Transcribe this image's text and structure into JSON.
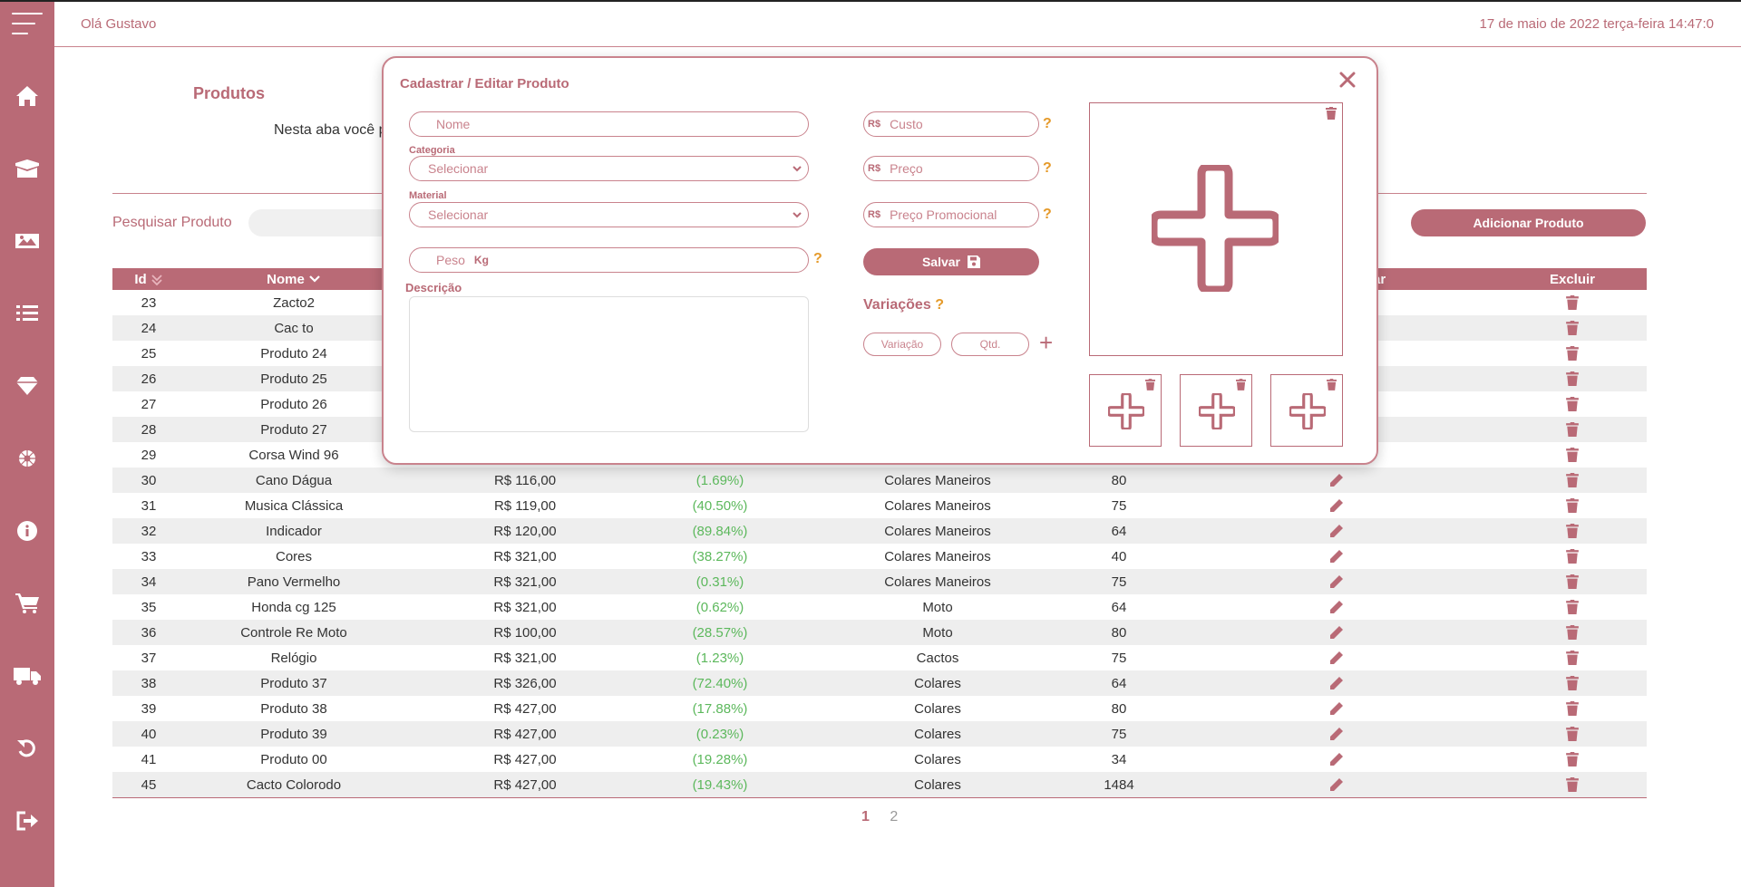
{
  "header": {
    "greeting": "Olá Gustavo",
    "datetime": "17 de maio de 2022 terça-feira 14:47:0"
  },
  "sidebar": {
    "items": [
      {
        "icon": "menu-icon"
      },
      {
        "icon": "home-icon"
      },
      {
        "icon": "box-icon"
      },
      {
        "icon": "image-icon"
      },
      {
        "icon": "list-icon"
      },
      {
        "icon": "diamond-icon"
      },
      {
        "icon": "settings-icon"
      },
      {
        "icon": "info-icon"
      },
      {
        "icon": "cart-icon"
      },
      {
        "icon": "truck-icon"
      },
      {
        "icon": "undo-icon"
      },
      {
        "icon": "logout-icon"
      }
    ]
  },
  "page": {
    "title": "Produtos",
    "description": "Nesta aba você p",
    "search_label": "Pesquisar Produto",
    "add_button": "Adicionar Produto"
  },
  "table": {
    "headers": {
      "id": "Id",
      "name": "Nome",
      "edit": "ar",
      "delete": "Excluir"
    },
    "rows": [
      {
        "id": "23",
        "name": "Zacto2",
        "price": "",
        "pct": "",
        "category": "",
        "qty": ""
      },
      {
        "id": "24",
        "name": "Cac to",
        "price": "",
        "pct": "",
        "category": "",
        "qty": ""
      },
      {
        "id": "25",
        "name": "Produto 24",
        "price": "",
        "pct": "",
        "category": "",
        "qty": ""
      },
      {
        "id": "26",
        "name": "Produto 25",
        "price": "",
        "pct": "",
        "category": "",
        "qty": ""
      },
      {
        "id": "27",
        "name": "Produto 26",
        "price": "",
        "pct": "",
        "category": "",
        "qty": ""
      },
      {
        "id": "28",
        "name": "Produto 27",
        "price": "",
        "pct": "",
        "category": "",
        "qty": ""
      },
      {
        "id": "29",
        "name": "Corsa Wind 96",
        "price": "",
        "pct": "",
        "category": "",
        "qty": ""
      },
      {
        "id": "30",
        "name": "Cano Dágua",
        "price": "R$ 116,00",
        "pct": "(1.69%)",
        "category": "Colares Maneiros",
        "qty": "80"
      },
      {
        "id": "31",
        "name": "Musica Clássica",
        "price": "R$ 119,00",
        "pct": "(40.50%)",
        "category": "Colares Maneiros",
        "qty": "75"
      },
      {
        "id": "32",
        "name": "Indicador",
        "price": "R$ 120,00",
        "pct": "(89.84%)",
        "category": "Colares Maneiros",
        "qty": "64"
      },
      {
        "id": "33",
        "name": "Cores",
        "price": "R$ 321,00",
        "pct": "(38.27%)",
        "category": "Colares Maneiros",
        "qty": "40"
      },
      {
        "id": "34",
        "name": "Pano Vermelho",
        "price": "R$ 321,00",
        "pct": "(0.31%)",
        "category": "Colares Maneiros",
        "qty": "75"
      },
      {
        "id": "35",
        "name": "Honda cg 125",
        "price": "R$ 321,00",
        "pct": "(0.62%)",
        "category": "Moto",
        "qty": "64"
      },
      {
        "id": "36",
        "name": "Controle Re Moto",
        "price": "R$ 100,00",
        "pct": "(28.57%)",
        "category": "Moto",
        "qty": "80"
      },
      {
        "id": "37",
        "name": "Relógio",
        "price": "R$ 321,00",
        "pct": "(1.23%)",
        "category": "Cactos",
        "qty": "75"
      },
      {
        "id": "38",
        "name": "Produto 37",
        "price": "R$ 326,00",
        "pct": "(72.40%)",
        "category": "Colares",
        "qty": "64"
      },
      {
        "id": "39",
        "name": "Produto 38",
        "price": "R$ 427,00",
        "pct": "(17.88%)",
        "category": "Colares",
        "qty": "80"
      },
      {
        "id": "40",
        "name": "Produto 39",
        "price": "R$ 427,00",
        "pct": "(0.23%)",
        "category": "Colares",
        "qty": "75"
      },
      {
        "id": "41",
        "name": "Produto 00",
        "price": "R$ 427,00",
        "pct": "(19.28%)",
        "category": "Colares",
        "qty": "34"
      },
      {
        "id": "45",
        "name": "Cacto Colorodo",
        "price": "R$ 427,00",
        "pct": "(19.43%)",
        "category": "Colares",
        "qty": "1484"
      }
    ]
  },
  "pagination": {
    "pages": [
      "1",
      "2"
    ],
    "current": "1"
  },
  "modal": {
    "title": "Cadastrar / Editar Produto",
    "name_placeholder": "Nome",
    "category_label": "Categoria",
    "category_value": "Selecionar",
    "material_label": "Material",
    "material_value": "Selecionar",
    "weight_placeholder": "Peso",
    "weight_unit": "Kg",
    "description_label": "Descrição",
    "currency": "R$",
    "cost_placeholder": "Custo",
    "price_placeholder": "Preço",
    "promo_placeholder": "Preço Promocional",
    "help": "?",
    "save_button": "Salvar",
    "variations_title": "Variações",
    "variation_placeholder": "Variação",
    "qty_placeholder": "Qtd.",
    "add_symbol": "+"
  },
  "colors": {
    "primary": "#b96a76",
    "primary_light": "#c9838d",
    "help": "#e59a2a",
    "positive": "#5cb85c"
  }
}
